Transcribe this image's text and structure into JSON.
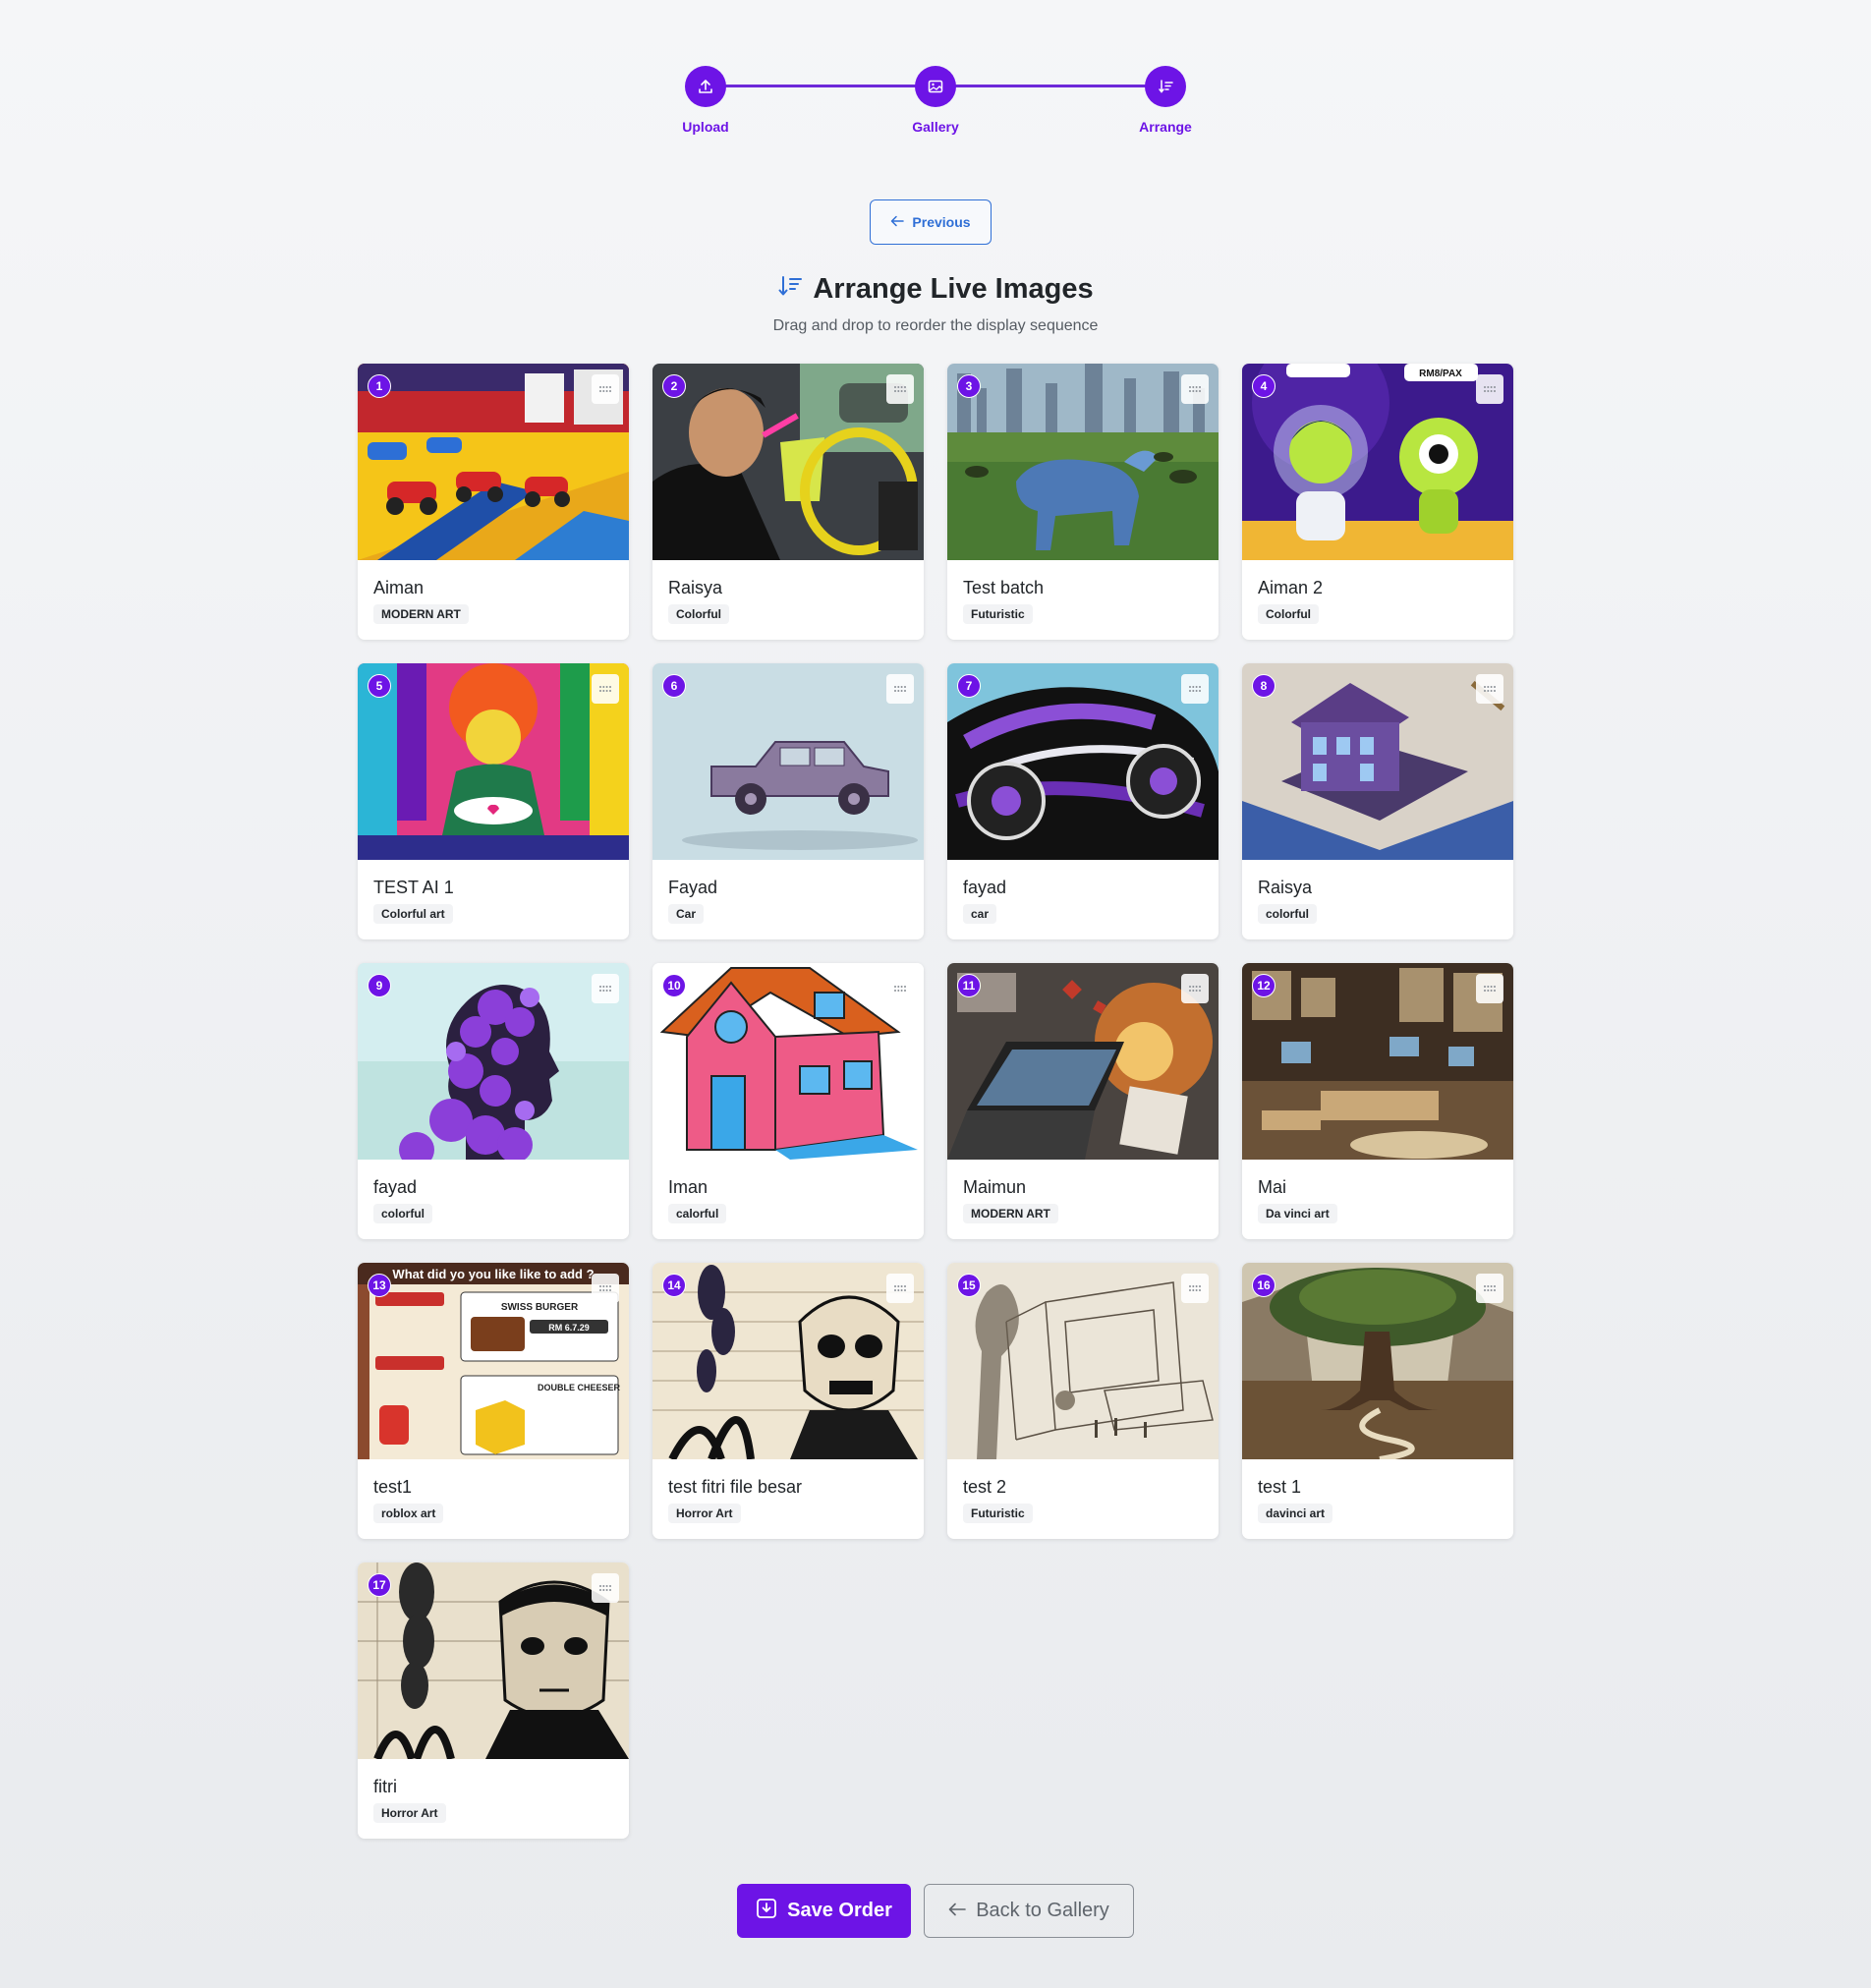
{
  "stepper": {
    "steps": [
      {
        "label": "Upload",
        "icon": "upload-icon"
      },
      {
        "label": "Gallery",
        "icon": "image-icon"
      },
      {
        "label": "Arrange",
        "icon": "sort-icon"
      }
    ],
    "accent": "#6d14e6"
  },
  "previous_button": {
    "label": "Previous",
    "icon": "arrow-left-icon"
  },
  "heading": {
    "title": "Arrange Live Images",
    "subtitle": "Drag and drop to reorder the display sequence",
    "icon": "sort-icon"
  },
  "cards": [
    {
      "order": "1",
      "title": "Aiman",
      "tag": "MODERN ART"
    },
    {
      "order": "2",
      "title": "Raisya",
      "tag": "Colorful"
    },
    {
      "order": "3",
      "title": "Test batch",
      "tag": "Futuristic"
    },
    {
      "order": "4",
      "title": "Aiman 2",
      "tag": "Colorful"
    },
    {
      "order": "5",
      "title": "TEST AI 1",
      "tag": "Colorful art"
    },
    {
      "order": "6",
      "title": "Fayad",
      "tag": "Car"
    },
    {
      "order": "7",
      "title": "fayad",
      "tag": "car"
    },
    {
      "order": "8",
      "title": "Raisya",
      "tag": "colorful"
    },
    {
      "order": "9",
      "title": "fayad",
      "tag": "colorful"
    },
    {
      "order": "10",
      "title": "Iman",
      "tag": "calorful"
    },
    {
      "order": "11",
      "title": "Maimun",
      "tag": "MODERN ART"
    },
    {
      "order": "12",
      "title": "Mai",
      "tag": "Da vinci art"
    },
    {
      "order": "13",
      "title": "test1",
      "tag": "roblox art"
    },
    {
      "order": "14",
      "title": "test fitri file besar",
      "tag": "Horror Art"
    },
    {
      "order": "15",
      "title": "test 2",
      "tag": "Futuristic"
    },
    {
      "order": "16",
      "title": "test 1",
      "tag": "davinci art"
    },
    {
      "order": "17",
      "title": "fitri",
      "tag": "Horror Art"
    }
  ],
  "image_text": {
    "speech_bubble_price": "RM8/PAX",
    "roblox_banner": "What did yo you like like to add ?",
    "roblox_swiss": "SWISS BURGER",
    "roblox_price": "RM 6.7.29",
    "roblox_double": "DOUBLE CHEESER"
  },
  "footer": {
    "save_label": "Save Order",
    "save_icon": "save-icon",
    "back_label": "Back to Gallery",
    "back_icon": "arrow-left-icon"
  }
}
